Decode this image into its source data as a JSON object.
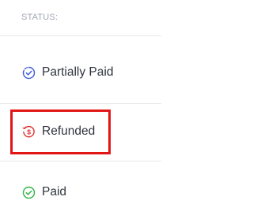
{
  "status_panel": {
    "header": "STATUS:",
    "items": [
      {
        "label": "Partially Paid",
        "icon": "partially-paid-icon",
        "color": "#3b5bdb"
      },
      {
        "label": "Refunded",
        "icon": "refund-icon",
        "color": "#e03131",
        "highlighted": true
      },
      {
        "label": "Paid",
        "icon": "check-circle-icon",
        "color": "#2fb344"
      }
    ],
    "highlight_color": "#e31616"
  }
}
